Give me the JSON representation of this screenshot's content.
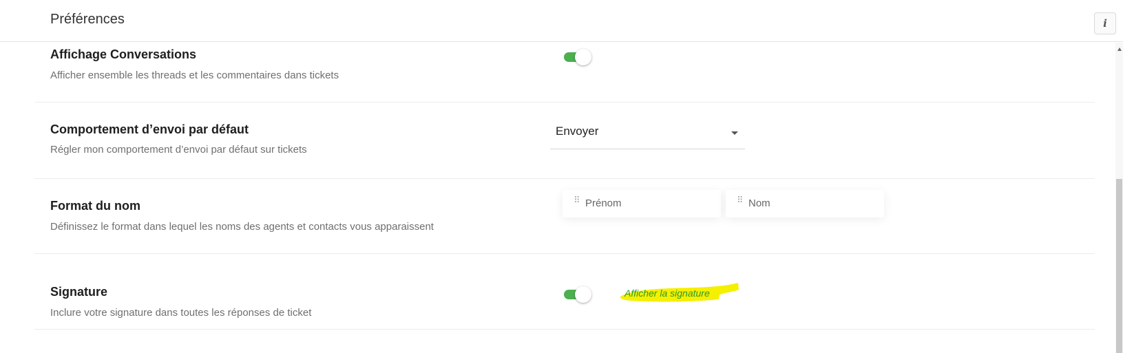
{
  "header": {
    "title": "Préférences",
    "info_icon_glyph": "i"
  },
  "settings": [
    {
      "id": "conversations",
      "label": "Affichage Conversations",
      "description": "Afficher ensemble les threads et les commentaires dans tickets",
      "control": "toggle",
      "enabled": true
    },
    {
      "id": "send-behavior",
      "label": "Comportement d’envoi par défaut",
      "description": "Régler mon comportement d’envoi par défaut sur tickets",
      "control": "select",
      "selected": "Envoyer"
    },
    {
      "id": "name-format",
      "label": "Format du nom",
      "description": "Définissez le format dans lequel les noms des agents et contacts vous apparaissent",
      "control": "sortable",
      "items": [
        "Prénom",
        "Nom"
      ]
    },
    {
      "id": "signature",
      "label": "Signature",
      "description": "Inclure votre signature dans toutes les réponses de ticket",
      "control": "toggle",
      "enabled": true
    }
  ],
  "annotation": {
    "text": "Afficher la signature",
    "highlight_color": "#f5ef00",
    "text_color": "#2b9a2b"
  },
  "colors": {
    "toggle_on": "#4caf50",
    "label": "#1e1e1e",
    "description": "#6f6f6f"
  },
  "icons": {
    "info": "info-icon",
    "dropdown": "caret-down-icon",
    "drag": "drag-handle-icon"
  }
}
